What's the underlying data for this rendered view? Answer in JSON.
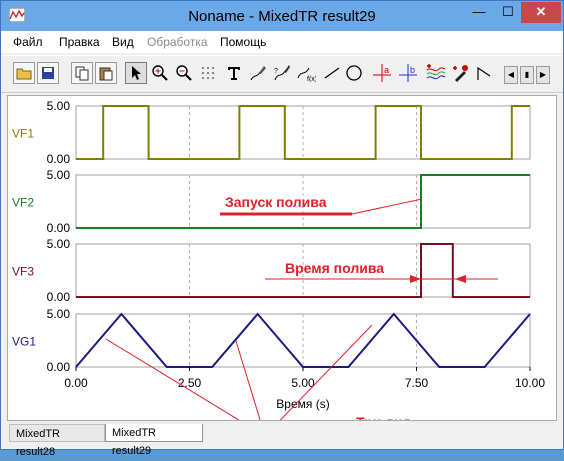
{
  "window": {
    "title": "Noname - MixedTR result29",
    "min_glyph": "—",
    "max_glyph": "☐",
    "close_glyph": "✕"
  },
  "menu": [
    {
      "label": "Файл",
      "enabled": true
    },
    {
      "label": "Правка",
      "enabled": true
    },
    {
      "label": "Вид",
      "enabled": true
    },
    {
      "label": "Обработка",
      "enabled": false
    },
    {
      "label": "Помощь",
      "enabled": true
    }
  ],
  "toolbar": [
    {
      "name": "open-icon"
    },
    {
      "name": "save-icon"
    },
    {
      "name": "copy-icon"
    },
    {
      "name": "paste-icon"
    },
    {
      "name": "cursor-icon"
    },
    {
      "name": "zoom-in-icon"
    },
    {
      "name": "zoom-out-icon"
    },
    {
      "name": "grid-icon"
    },
    {
      "name": "text-icon"
    },
    {
      "name": "pen-icon"
    },
    {
      "name": "marker-icon"
    },
    {
      "name": "formula-icon"
    },
    {
      "name": "line-icon"
    },
    {
      "name": "circle-icon"
    },
    {
      "name": "cursor-a-icon",
      "glyph": "a"
    },
    {
      "name": "cursor-b-icon",
      "glyph": "b"
    },
    {
      "name": "waveforms-icon"
    },
    {
      "name": "color-picker-icon"
    },
    {
      "name": "polyline-icon"
    },
    {
      "name": "scroll-left-icon"
    },
    {
      "name": "scroll-right-icon"
    }
  ],
  "tabs": [
    {
      "label": "MixedTR result28",
      "active": false
    },
    {
      "label": "MixedTR result29",
      "active": true
    }
  ],
  "chart_data": {
    "type": "line",
    "xlabel": "Время (s)",
    "xlim": [
      0,
      10
    ],
    "x_ticks": [
      "0.00",
      "2.50",
      "5.00",
      "7.50",
      "10.00"
    ],
    "grid": true,
    "panels": [
      {
        "name": "VF1",
        "color": "#808000",
        "ylim": [
          0,
          5
        ],
        "y_ticks": [
          "5.00",
          "0.00"
        ],
        "x": [
          0,
          0.6,
          0.6,
          1.6,
          1.6,
          3.6,
          3.6,
          4.6,
          4.6,
          6.6,
          6.6,
          7.6,
          7.6,
          9.6,
          9.6,
          10
        ],
        "y": [
          0,
          0,
          5,
          5,
          0,
          0,
          5,
          5,
          0,
          0,
          5,
          5,
          0,
          0,
          5,
          5
        ]
      },
      {
        "name": "VF2",
        "color": "#1a7f1a",
        "ylim": [
          0,
          5
        ],
        "y_ticks": [
          "5.00",
          "0.00"
        ],
        "x": [
          0,
          7.6,
          7.6,
          10
        ],
        "y": [
          0,
          0,
          5,
          5
        ]
      },
      {
        "name": "VF3",
        "color": "#7a0f1e",
        "ylim": [
          0,
          5
        ],
        "y_ticks": [
          "5.00",
          "0.00"
        ],
        "x": [
          0,
          7.6,
          7.6,
          8.3,
          8.3,
          10
        ],
        "y": [
          0,
          0,
          5,
          5,
          0,
          0
        ]
      },
      {
        "name": "VG1",
        "color": "#1a1a80",
        "ylim": [
          0,
          5
        ],
        "y_ticks": [
          "5.00",
          "0.00"
        ],
        "x": [
          0,
          1,
          2,
          3,
          4,
          5,
          6,
          7,
          8,
          9,
          10
        ],
        "y": [
          0,
          5,
          0,
          0,
          5,
          0,
          0,
          5,
          0,
          0,
          5
        ]
      }
    ],
    "annotations": [
      {
        "text": "Запуск полива",
        "color": "#e0202a"
      },
      {
        "text": "Время полива",
        "color": "#e0202a"
      },
      {
        "text": "Три дня",
        "color": "#e0202a"
      }
    ]
  }
}
